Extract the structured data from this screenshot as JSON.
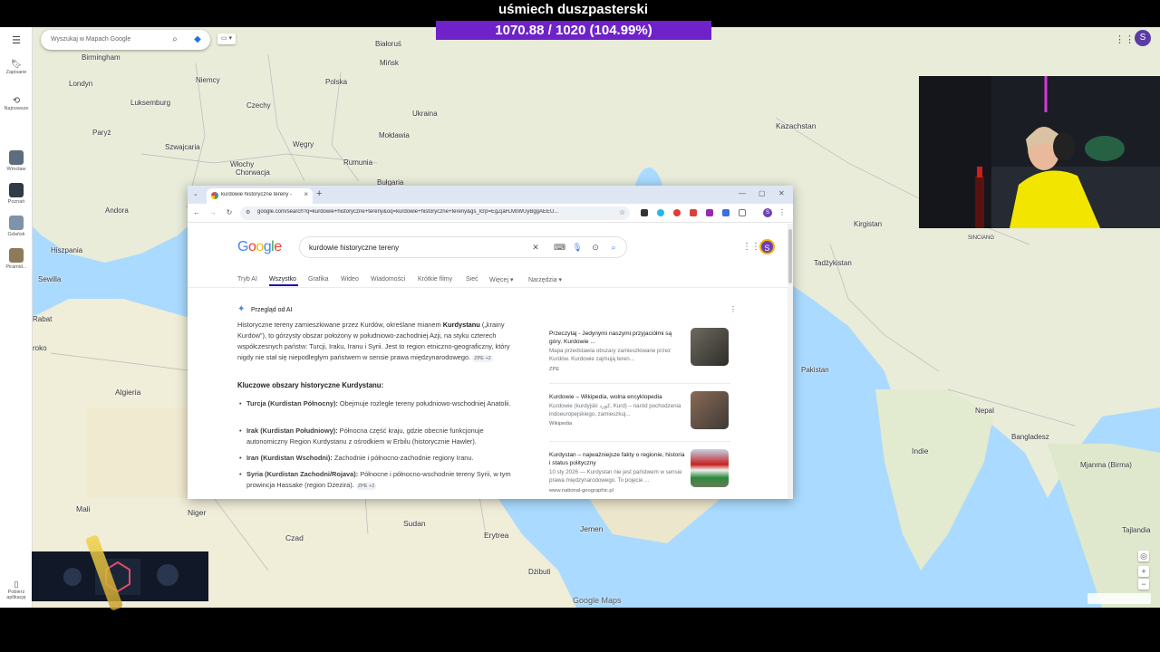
{
  "overlay": {
    "title": "uśmiech duszpasterski",
    "progress_text": "1070.88 / 1020 (104.99%)",
    "progress_fraction": 1.0
  },
  "maps": {
    "search_placeholder": "Wyszukaj w Mapach Google",
    "avatar_letter": "S",
    "logo": "Google Maps",
    "rail": {
      "saved": "Zapisane",
      "recent": "Najnowsze",
      "places": [
        "Wrocław",
        "Poznań",
        "Gdańsk",
        "Piramid..."
      ],
      "download": "Pobierz aplikację"
    },
    "labels": [
      "Birmingham",
      "Londyn",
      "Luksemburg",
      "Paryż",
      "Szwajcaria",
      "Włochy",
      "Andora",
      "Hiszpania",
      "Sewilla",
      "Rabat",
      "roko",
      "Algieria",
      "Mali",
      "Niger",
      "Czad",
      "Sudan",
      "Erytrea",
      "Jemen",
      "Dżibuti",
      "Niemcy",
      "Białoruś",
      "Polska",
      "Czechy",
      "Ukraina",
      "Mołdawia",
      "Węgry",
      "Rumunia",
      "Chorwacja",
      "Bułgaria",
      "Kazachstan",
      "Kirgistan",
      "Tadżykistan",
      "Pakistan",
      "Indie",
      "Nepal",
      "Bangladesz",
      "Mjanma (Birma)",
      "Tajlandia",
      "SINCIANG",
      "Mińsk"
    ]
  },
  "browser": {
    "tab_title": "kurdowie historyczne tereny - ",
    "url": "google.com/search?q=kurdowie+historyczne+tereny&oq=kurdowie+historyczne+tereny&gs_lcrp=EgZjaHJvbWUyBggAEEU...",
    "profile_letter": "S"
  },
  "google": {
    "logo": "Google",
    "query": "kurdowie historyczne tereny",
    "avatar_letter": "S",
    "tabs": [
      "Tryb AI",
      "Wszystko",
      "Grafika",
      "Wideo",
      "Wiadomości",
      "Krótkie filmy",
      "Sieć",
      "Więcej",
      "Narzędzia"
    ],
    "ai": {
      "header": "Przegląd od AI",
      "para_1": "Historyczne tereny zamieszkiwane przez Kurdów, określane mianem ",
      "para_bold": "Kurdystanu",
      "para_2": " („krainy Kurdów”), to górzysty obszar położony w południowo-zachodniej Azji, na styku czterech współczesnych państw: Turcji, Iraku, Iranu i Syrii. Jest to region etniczno-geograficzny, który nigdy nie stał się niepodległym państwem w sensie prawa międzynarodowego.",
      "cite": "ZPE +2",
      "subhead": "Kluczowe obszary historyczne Kurdystanu:",
      "items": [
        {
          "bold": "Turcja (Kurdistan Północny):",
          "text": " Obejmuje rozległe tereny południowo-wschodniej Anatolii."
        },
        {
          "bold": "Irak (Kurdistan Południowy):",
          "text": " Północna część kraju, gdzie obecnie funkcjonuje autonomiczny Region Kurdystanu z ośrodkiem w Erbilu (historycznie Hawler)."
        },
        {
          "bold": "Iran (Kurdistan Wschodni):",
          "text": " Zachodnie i północno-zachodnie regiony Iranu."
        },
        {
          "bold": "Syria (Kurdistan Zachodni/Rojava):",
          "text": " Północne i północno-wschodnie tereny Syrii, w tym prowincja Hassake (region Dżezira).",
          "cite": "ZPE +2"
        }
      ]
    },
    "sources": [
      {
        "title": "Przeczytaj - Jedynymi naszymi przyjaciółmi są góry. Kurdowie ...",
        "desc": "Mapa przedstawia obszary zamieszkiwane przez Kurdów. Kurdowie zajmują teren...",
        "site": "ZPE"
      },
      {
        "title": "Kurdowie – Wikipedia, wolna encyklopedia",
        "desc": "Kurdowie (kurdyjski کورد, Kurd) – naród pochodzenia indoeuropejskiego, zamieszkuj...",
        "site": "Wikipedia"
      },
      {
        "title": "Kurdystan – najważniejsze fakty o regionie, historia i status polityczny",
        "desc": "10 sty 2026 — Kurdystan nie jest państwem w sensie prawa międzynarodowego. To pojęcie ...",
        "site": "www.national-geographic.pl"
      }
    ]
  },
  "colors": {
    "overlay_bar": "#7b2bd6",
    "map_water": "#aadaff",
    "map_land": "#e8ecd9",
    "google_blue": "#4285f4"
  }
}
